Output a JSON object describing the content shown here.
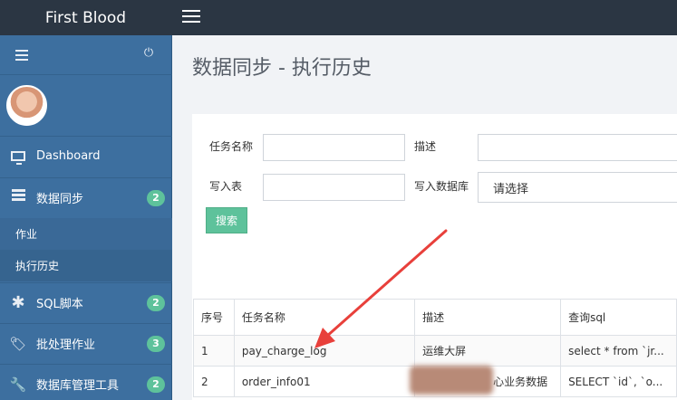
{
  "brand": "First Blood",
  "sidebar": {
    "nav": [
      {
        "label": "Dashboard",
        "badge": ""
      },
      {
        "label": "数据同步",
        "badge": "2"
      },
      {
        "label": "SQL脚本",
        "badge": "2"
      },
      {
        "label": "批处理作业",
        "badge": "3"
      },
      {
        "label": "数据库管理工具",
        "badge": "2"
      }
    ],
    "sub_items": [
      "作业",
      "执行历史"
    ]
  },
  "page": {
    "title": "数据同步 - 执行历史"
  },
  "form": {
    "task_name_label": "任务名称",
    "task_name_value": "",
    "desc_label": "描述",
    "desc_value": "",
    "write_table_label": "写入表",
    "write_table_value": "",
    "write_db_label": "写入数据库",
    "write_db_value": "请选择",
    "search_label": "搜索"
  },
  "table": {
    "headers": [
      "序号",
      "任务名称",
      "描述",
      "查询sql"
    ],
    "rows": [
      [
        "1",
        "pay_charge_log",
        "运维大屏",
        "select * from `jr..."
      ],
      [
        "2",
        "order_info01",
        "心业务数据",
        "SELECT `id`, `o..."
      ]
    ]
  },
  "colors": {
    "accent": "#5ec29b",
    "sidebar": "#3d6f9f",
    "topbar": "#2b3643",
    "arrow": "#e8403b"
  }
}
